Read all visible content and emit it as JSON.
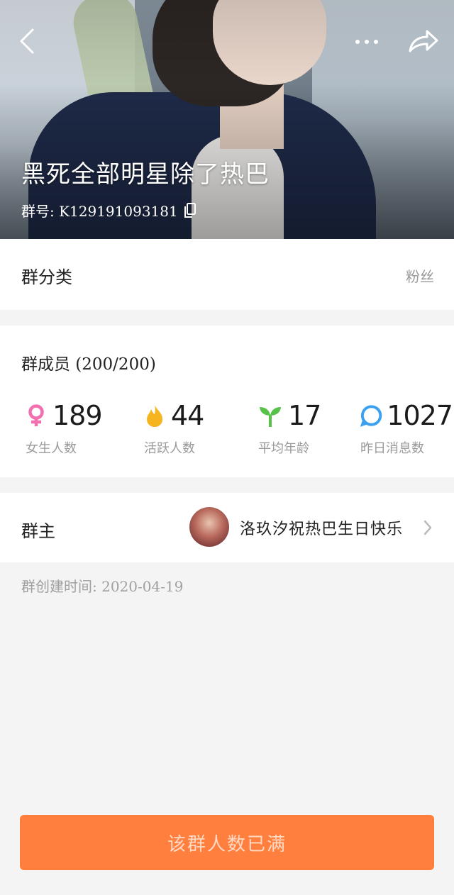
{
  "header": {
    "group_name": "黑死全部明星除了热巴",
    "group_id_label": "群号: K129191093181"
  },
  "category": {
    "label": "群分类",
    "value": "粉丝"
  },
  "members": {
    "label": "群成员 (200/200)",
    "stats": [
      {
        "icon": "female-icon",
        "value": "189",
        "caption": "女生人数",
        "color": "#f26fb0"
      },
      {
        "icon": "flame-icon",
        "value": "44",
        "caption": "活跃人数",
        "color": "#f6b51f"
      },
      {
        "icon": "sprout-icon",
        "value": "17",
        "caption": "平均年龄",
        "color": "#57c14a"
      },
      {
        "icon": "message-bubble-icon",
        "value": "1027",
        "caption": "昨日消息数",
        "color": "#3aa0f0"
      }
    ]
  },
  "owner": {
    "label": "群主",
    "name": "洛玖汐祝热巴生日快乐"
  },
  "created": "群创建时间: 2020-04-19",
  "join_button": {
    "label": "该群人数已满",
    "color": "#ff7f3e"
  }
}
